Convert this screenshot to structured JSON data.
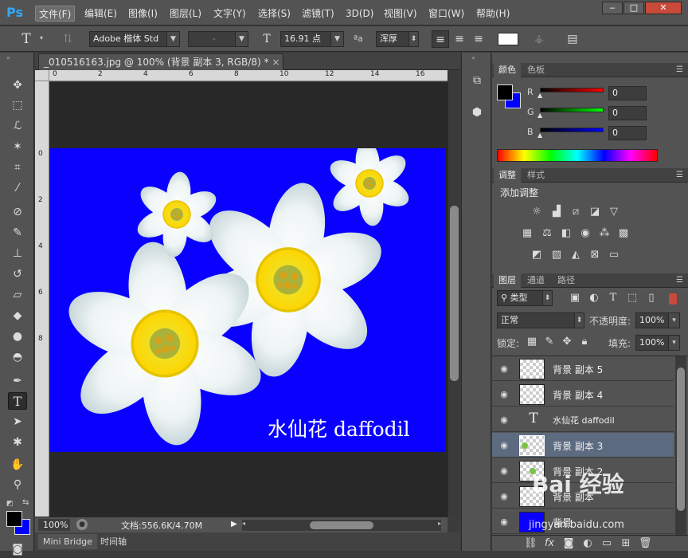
{
  "app": {
    "logo": "Ps"
  },
  "menu": [
    "文件(F)",
    "编辑(E)",
    "图像(I)",
    "图层(L)",
    "文字(Y)",
    "选择(S)",
    "滤镜(T)",
    "3D(D)",
    "视图(V)",
    "窗口(W)",
    "帮助(H)"
  ],
  "window_controls": {
    "minimize": "‒",
    "restore": "□",
    "close": "✕"
  },
  "options": {
    "font_family": "Adobe 楷体 Std",
    "font_style": "-",
    "font_size": "16.91 点",
    "aa_label": "ªa",
    "antialias": "浑厚"
  },
  "document": {
    "tab_title": "_010516163.jpg @ 100% (背景 副本 3, RGB/8) *",
    "tab_close": "×",
    "ruler_h": [
      "0",
      "2",
      "4",
      "6",
      "8",
      "10",
      "12",
      "14",
      "16"
    ],
    "ruler_v": [
      "0",
      "2",
      "4",
      "6",
      "8"
    ],
    "canvas_text": "水仙花 daffodil",
    "canvas_bg": "#0a00ff"
  },
  "status": {
    "zoom": "100%",
    "doc_info": "文档:556.6K/4.70M"
  },
  "bottom_tabs": [
    "Mini Bridge",
    "时间轴"
  ],
  "color_panel": {
    "tabs": [
      "颜色",
      "色板"
    ],
    "channels": [
      {
        "label": "R",
        "value": "0"
      },
      {
        "label": "G",
        "value": "0"
      },
      {
        "label": "B",
        "value": "0"
      }
    ],
    "foreground": "#000000",
    "background": "#0000ff"
  },
  "adjust_panel": {
    "tabs": [
      "调整",
      "样式"
    ],
    "title": "添加调整"
  },
  "layers_panel": {
    "tabs": [
      "图层",
      "通道",
      "路径"
    ],
    "filter": "类型",
    "blend_mode": "正常",
    "opacity_label": "不透明度:",
    "opacity": "100%",
    "lock_label": "锁定:",
    "fill_label": "填充:",
    "fill": "100%",
    "layers": [
      {
        "name": "背景 副本 5",
        "kind": "pixel",
        "selected": false
      },
      {
        "name": "背景 副本 4",
        "kind": "pixel",
        "selected": false
      },
      {
        "name": "水仙花 daffodil",
        "kind": "text",
        "selected": false
      },
      {
        "name": "背景 副本 3",
        "kind": "pixel",
        "selected": true
      },
      {
        "name": "背景 副本 2",
        "kind": "pixel",
        "selected": false
      },
      {
        "name": "背景 副本",
        "kind": "pixel",
        "selected": false
      },
      {
        "name": "背景",
        "kind": "fill",
        "selected": false
      }
    ]
  },
  "watermark": {
    "text": "Bai 经验",
    "url": "jingyan.baidu.com"
  }
}
